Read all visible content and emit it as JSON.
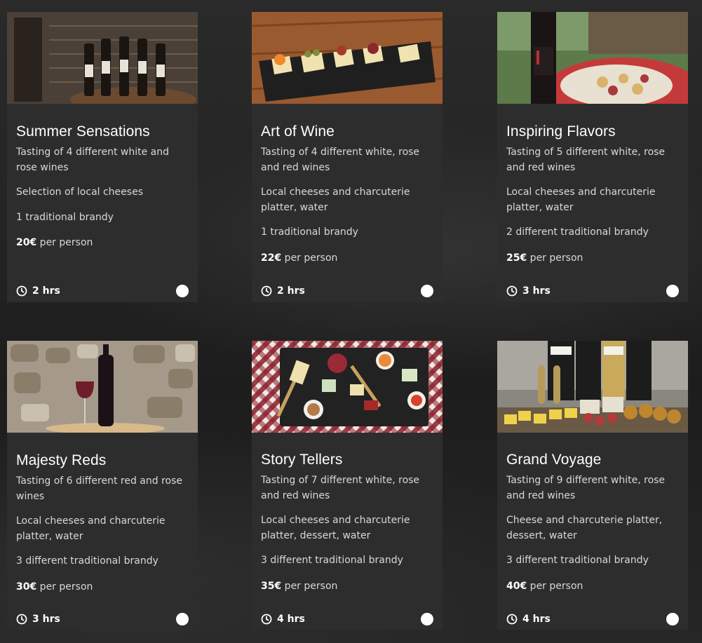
{
  "cards": [
    {
      "title": "Summer Sensations",
      "lines": [
        "Tasting of 4 different white and rose wines",
        "Selection of local cheeses",
        "1 traditional brandy"
      ],
      "price": "20€",
      "price_suffix": " per person",
      "duration": "2 hrs",
      "image": "wine-cellar-bottles-photo"
    },
    {
      "title": "Art of Wine",
      "lines": [
        "Tasting of 4 different white, rose and red wines",
        "Local cheeses and charcuterie platter, water",
        "1 traditional brandy"
      ],
      "price": "22€",
      "price_suffix": " per person",
      "duration": "2 hrs",
      "image": "slate-appetizer-board-photo"
    },
    {
      "title": "Inspiring Flavors",
      "lines": [
        "Tasting of 5 different white, rose and red wines",
        "Local cheeses and charcuterie platter, water",
        "2 different traditional brandy"
      ],
      "price": "25€",
      "price_suffix": " per person",
      "duration": "3 hrs",
      "image": "outdoor-wine-platter-photo"
    },
    {
      "title": "Majesty Reds",
      "lines": [
        "Tasting of 6 different red and rose wines",
        "Local cheeses and charcuterie platter, water",
        "3 different traditional brandy"
      ],
      "price": "30€",
      "price_suffix": " per person",
      "duration": "3 hrs",
      "image": "red-wine-stone-wall-photo"
    },
    {
      "title": "Story Tellers",
      "lines": [
        "Tasting of 7 different white, rose and red wines",
        "Local cheeses and charcuterie platter, dessert, water",
        "3 different traditional brandy"
      ],
      "price": "35€",
      "price_suffix": " per person",
      "duration": "4 hrs",
      "image": "checkered-cloth-platter-photo"
    },
    {
      "title": "Grand Voyage",
      "lines": [
        "Tasting of 9 different white, rose and red wines",
        "Cheese and charcuterie platter, dessert, water",
        "3 different traditional brandy"
      ],
      "price": "40€",
      "price_suffix": " per person",
      "duration": "4 hrs",
      "image": "bottles-cheese-crackers-photo"
    }
  ],
  "colors": {
    "card_bg": "#2d2d2d",
    "text_primary": "#ffffff",
    "text_secondary": "#d8d8d8",
    "radio": "#ffffff"
  }
}
